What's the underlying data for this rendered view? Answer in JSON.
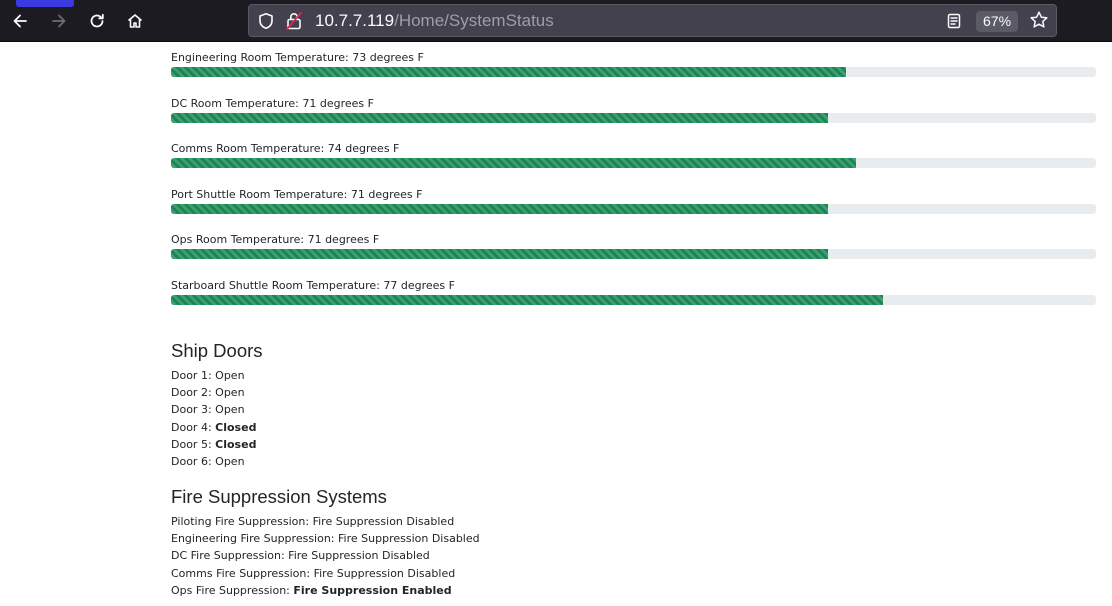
{
  "browser": {
    "url_host": "10.7.7.119",
    "url_path": "/Home/SystemStatus",
    "zoom": "67%"
  },
  "temperatures": [
    {
      "label": "Engineering Room Temperature: 73 degrees F",
      "percent": 73
    },
    {
      "label": "DC Room Temperature: 71 degrees F",
      "percent": 71
    },
    {
      "label": "Comms Room Temperature: 74 degrees F",
      "percent": 74
    },
    {
      "label": "Port Shuttle Room Temperature: 71 degrees F",
      "percent": 71
    },
    {
      "label": "Ops Room Temperature: 71 degrees F",
      "percent": 71
    },
    {
      "label": "Starboard Shuttle Room Temperature: 77 degrees F",
      "percent": 77
    }
  ],
  "doors": {
    "title": "Ship Doors",
    "items": [
      {
        "name": "Door 1: ",
        "status": "Open",
        "bold": false
      },
      {
        "name": "Door 2: ",
        "status": "Open",
        "bold": false
      },
      {
        "name": "Door 3: ",
        "status": "Open",
        "bold": false
      },
      {
        "name": "Door 4: ",
        "status": "Closed",
        "bold": true
      },
      {
        "name": "Door 5: ",
        "status": "Closed",
        "bold": true
      },
      {
        "name": "Door 6: ",
        "status": "Open",
        "bold": false
      }
    ]
  },
  "fire": {
    "title": "Fire Suppression Systems",
    "items": [
      {
        "name": "Piloting Fire Suppression: ",
        "status": "Fire Suppression Disabled",
        "bold": false
      },
      {
        "name": "Engineering Fire Suppression: ",
        "status": "Fire Suppression Disabled",
        "bold": false
      },
      {
        "name": "DC Fire Suppression: ",
        "status": "Fire Suppression Disabled",
        "bold": false
      },
      {
        "name": "Comms Fire Suppression: ",
        "status": "Fire Suppression Disabled",
        "bold": false
      },
      {
        "name": "Ops Fire Suppression: ",
        "status": "Fire Suppression Enabled",
        "bold": true
      }
    ]
  },
  "colors": {
    "progress_fill": "#198754",
    "progress_track": "#e9ecef",
    "toolbar_bg": "#1c1b22"
  }
}
